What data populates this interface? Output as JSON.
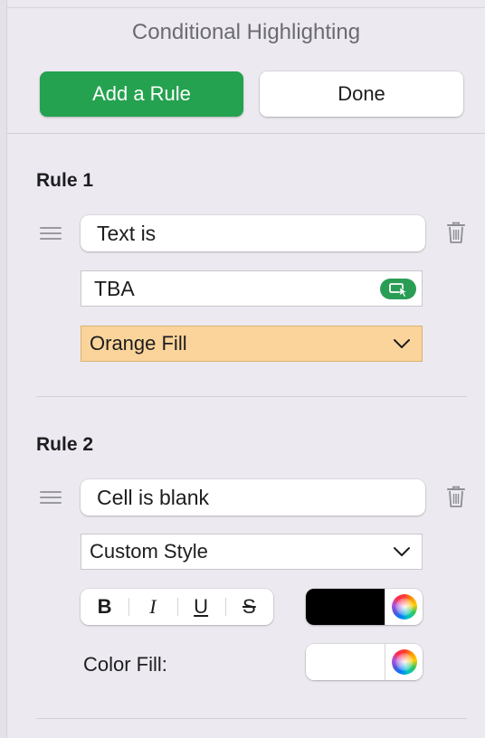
{
  "panel": {
    "title": "Conditional Highlighting"
  },
  "buttons": {
    "add_rule": "Add a Rule",
    "done": "Done"
  },
  "rules": [
    {
      "title": "Rule 1",
      "condition": "Text is",
      "value": "TBA",
      "style": "Orange Fill",
      "style_color": "#FAD49A"
    },
    {
      "title": "Rule 2",
      "condition": "Cell is blank",
      "style": "Custom Style",
      "format_buttons": {
        "bold": "B",
        "italic": "I",
        "underline": "U",
        "strikethrough": "S"
      },
      "text_color": "#000000",
      "color_fill_label": "Color Fill:",
      "fill_color": "#FFFFFF"
    }
  ],
  "colors": {
    "accent": "#24A24F",
    "cell_ref_button": "#2A9D55"
  }
}
